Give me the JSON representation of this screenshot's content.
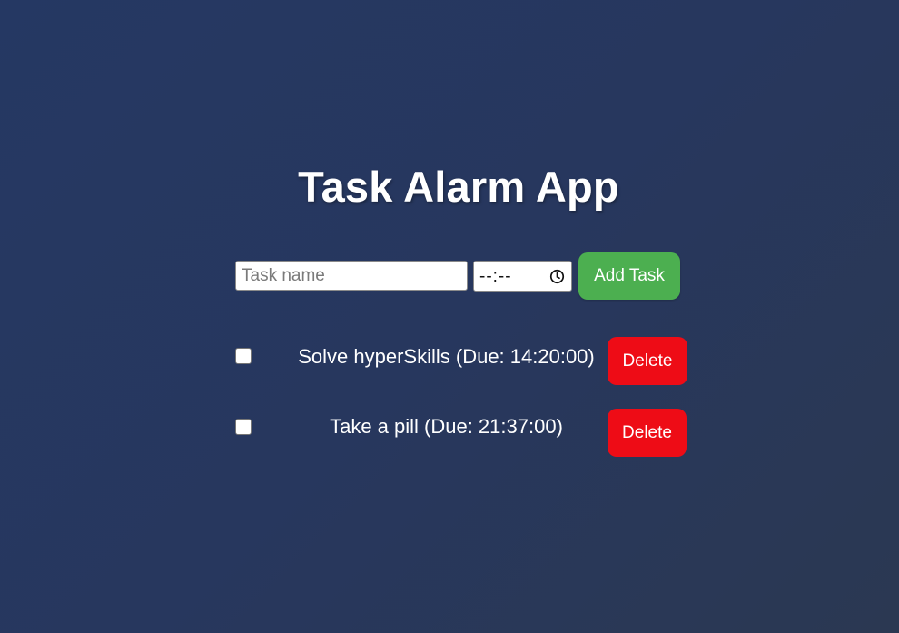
{
  "app": {
    "title": "Task Alarm App"
  },
  "form": {
    "task_placeholder": "Task name",
    "task_value": "",
    "time_display": "--:--",
    "add_label": "Add Task"
  },
  "tasks": [
    {
      "text": "Solve hyperSkills (Due: 14:20:00)",
      "checked": false,
      "delete_label": "Delete"
    },
    {
      "text": "Take a pill (Due: 21:37:00)",
      "checked": false,
      "delete_label": "Delete"
    }
  ],
  "colors": {
    "background": "#27375e",
    "add_button": "#4caf50",
    "delete_button": "#ee0c16",
    "text": "#ffffff"
  },
  "icons": {
    "time_picker": "clock-icon"
  }
}
